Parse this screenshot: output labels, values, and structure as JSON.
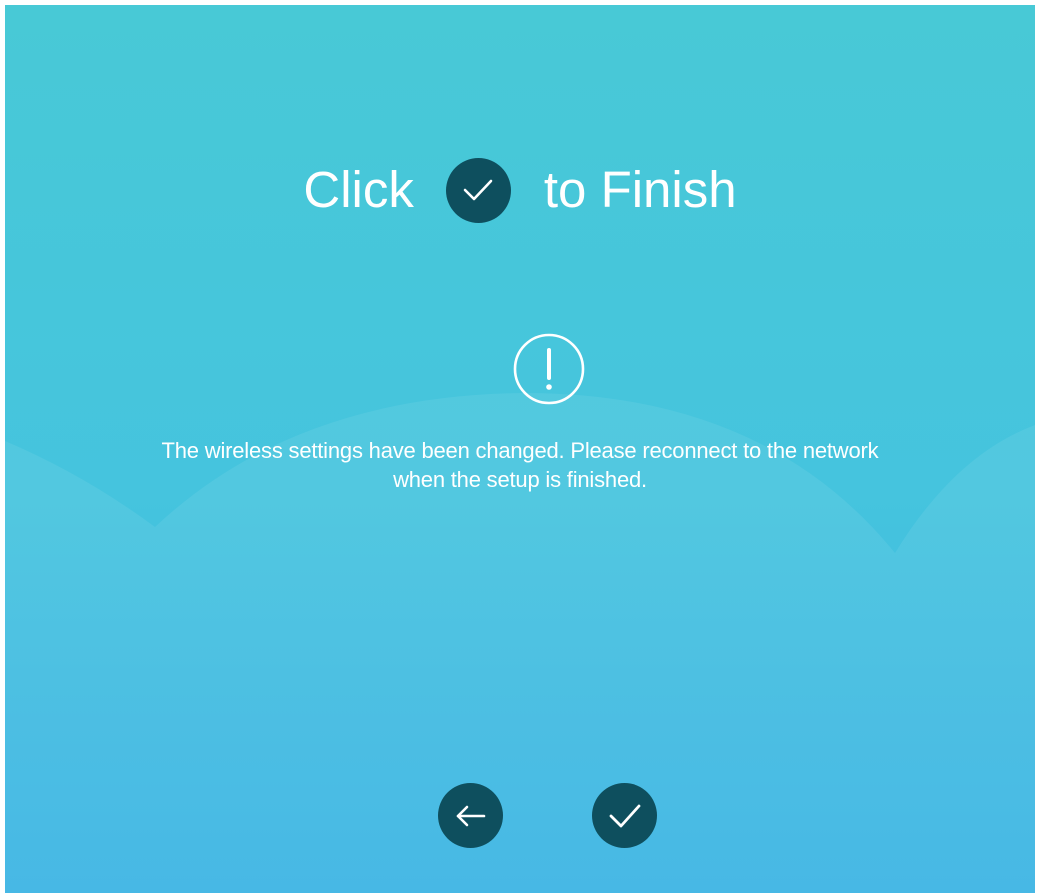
{
  "title": {
    "before": "Click",
    "after": "to Finish",
    "icon": "check-icon"
  },
  "notice": {
    "icon": "exclamation-circle-icon",
    "line1": "The wireless settings have been changed. Please reconnect to the network",
    "line2": "when the setup is finished."
  },
  "buttons": {
    "back_icon": "arrow-left-icon",
    "finish_icon": "check-icon"
  },
  "colors": {
    "background_top": "#48c9d6",
    "background_mid": "#45c4de",
    "background_bottom": "#3ab3e3",
    "button": "#0e4f5e",
    "text": "#ffffff"
  }
}
